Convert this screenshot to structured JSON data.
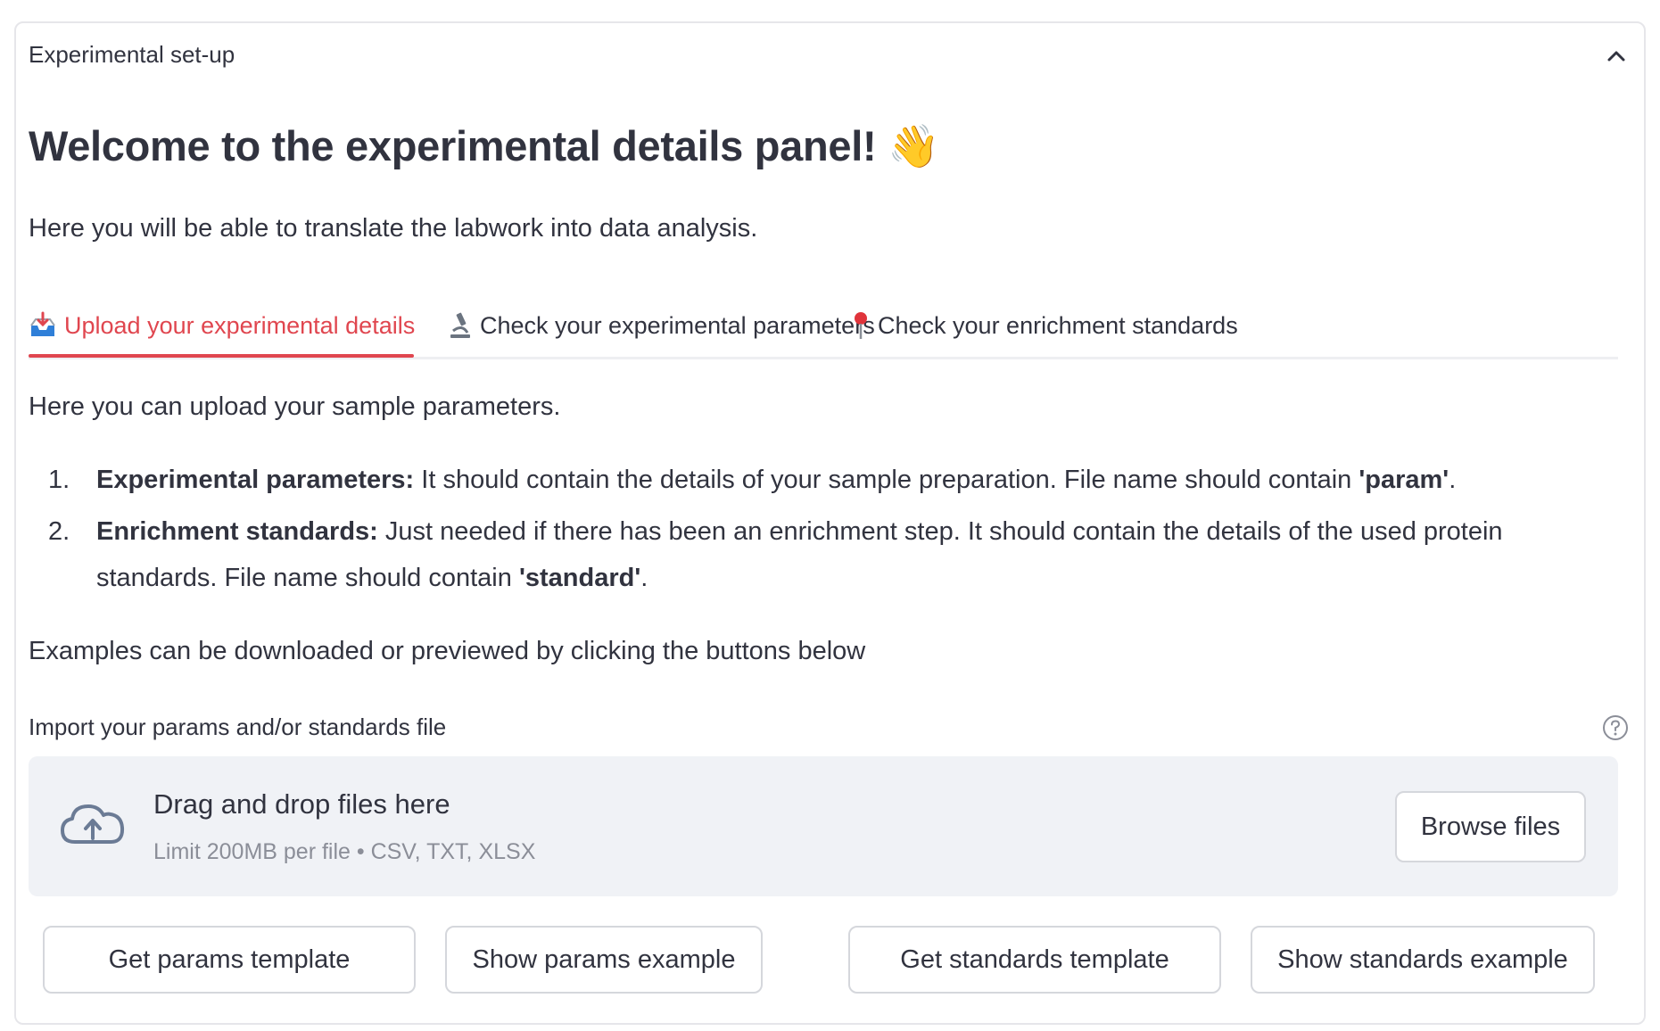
{
  "expander": {
    "header": "Experimental set-up"
  },
  "panel": {
    "title": "Welcome to the experimental details panel!",
    "title_emoji": "👋",
    "intro": "Here you will be able to translate the labwork into data analysis."
  },
  "tabs": [
    {
      "label": "Upload your experimental details",
      "icon": "inbox-tray-icon",
      "active": true
    },
    {
      "label": "Check your experimental parameters",
      "icon": "microscope-icon",
      "active": false
    },
    {
      "label": "Check your enrichment standards",
      "icon": "pushpin-icon",
      "active": false
    }
  ],
  "content": {
    "lead": "Here you can upload your sample parameters.",
    "items": [
      {
        "num": "1.",
        "bold": "Experimental parameters:",
        "text": " It should contain the details of your sample preparation. File name should contain ",
        "bold2": "'param'",
        "end": "."
      },
      {
        "num": "2.",
        "bold": "Enrichment standards:",
        "text": " Just needed if there has been an enrichment step. It should contain the details of the used protein standards. File name should contain ",
        "bold2": "'standard'",
        "end": "."
      }
    ],
    "examples_note": "Examples can be downloaded or previewed by clicking the buttons below"
  },
  "uploader": {
    "label": "Import your params and/or standards file",
    "drop_title": "Drag and drop files here",
    "drop_limit": "Limit 200MB per file • CSV, TXT, XLSX",
    "browse_label": "Browse files"
  },
  "buttons": {
    "get_params": "Get params template",
    "show_params": "Show params example",
    "get_standards": "Get standards template",
    "show_standards": "Show standards example"
  },
  "colors": {
    "accent": "#e0464f",
    "text": "#31333f",
    "dropzone_bg": "#f0f2f6"
  }
}
